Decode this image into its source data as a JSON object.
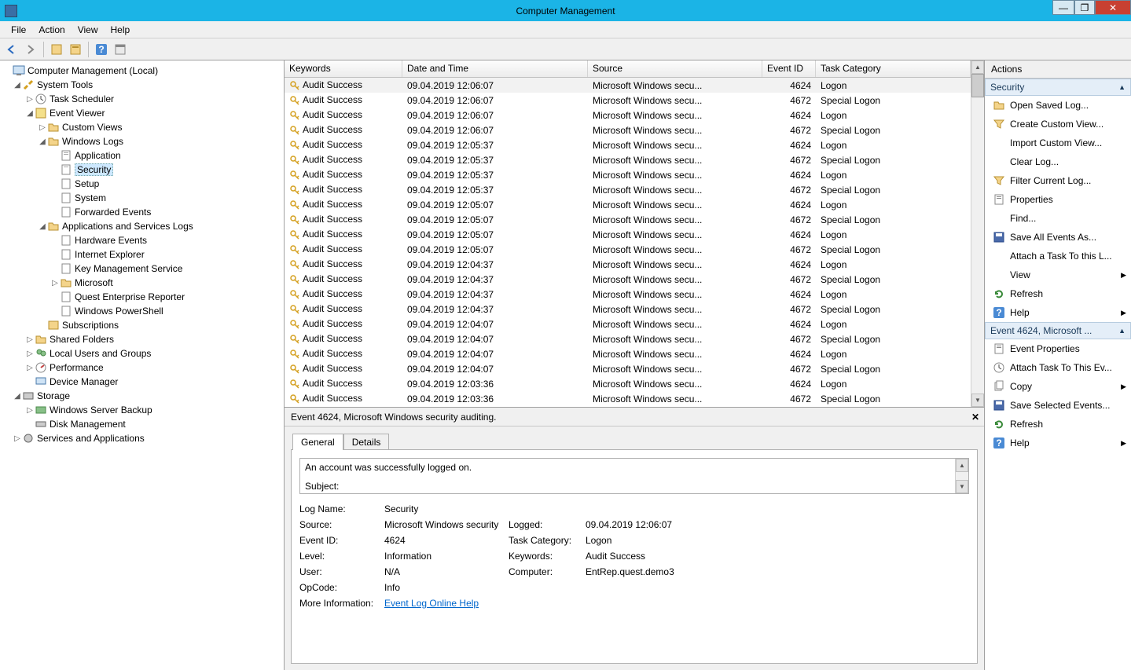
{
  "window": {
    "title": "Computer Management"
  },
  "menubar": [
    "File",
    "Action",
    "View",
    "Help"
  ],
  "tree": {
    "root": "Computer Management (Local)",
    "system_tools": "System Tools",
    "task_scheduler": "Task Scheduler",
    "event_viewer": "Event Viewer",
    "custom_views": "Custom Views",
    "windows_logs": "Windows Logs",
    "application": "Application",
    "security": "Security",
    "setup": "Setup",
    "system": "System",
    "forwarded": "Forwarded Events",
    "app_svc_logs": "Applications and Services Logs",
    "hw_events": "Hardware Events",
    "ie": "Internet Explorer",
    "kms": "Key Management Service",
    "microsoft": "Microsoft",
    "quest": "Quest Enterprise Reporter",
    "powershell": "Windows PowerShell",
    "subscriptions": "Subscriptions",
    "shared_folders": "Shared Folders",
    "local_users": "Local Users and Groups",
    "performance": "Performance",
    "device_manager": "Device Manager",
    "storage": "Storage",
    "wsb": "Windows Server Backup",
    "disk_mgmt": "Disk Management",
    "services_apps": "Services and Applications"
  },
  "table": {
    "headers": {
      "keywords": "Keywords",
      "datetime": "Date and Time",
      "source": "Source",
      "eventid": "Event ID",
      "taskcat": "Task Category"
    },
    "rows": [
      {
        "kw": "Audit Success",
        "dt": "09.04.2019 12:06:07",
        "src": "Microsoft Windows secu...",
        "eid": "4624",
        "tc": "Logon",
        "sel": true
      },
      {
        "kw": "Audit Success",
        "dt": "09.04.2019 12:06:07",
        "src": "Microsoft Windows secu...",
        "eid": "4672",
        "tc": "Special Logon"
      },
      {
        "kw": "Audit Success",
        "dt": "09.04.2019 12:06:07",
        "src": "Microsoft Windows secu...",
        "eid": "4624",
        "tc": "Logon"
      },
      {
        "kw": "Audit Success",
        "dt": "09.04.2019 12:06:07",
        "src": "Microsoft Windows secu...",
        "eid": "4672",
        "tc": "Special Logon"
      },
      {
        "kw": "Audit Success",
        "dt": "09.04.2019 12:05:37",
        "src": "Microsoft Windows secu...",
        "eid": "4624",
        "tc": "Logon"
      },
      {
        "kw": "Audit Success",
        "dt": "09.04.2019 12:05:37",
        "src": "Microsoft Windows secu...",
        "eid": "4672",
        "tc": "Special Logon"
      },
      {
        "kw": "Audit Success",
        "dt": "09.04.2019 12:05:37",
        "src": "Microsoft Windows secu...",
        "eid": "4624",
        "tc": "Logon"
      },
      {
        "kw": "Audit Success",
        "dt": "09.04.2019 12:05:37",
        "src": "Microsoft Windows secu...",
        "eid": "4672",
        "tc": "Special Logon"
      },
      {
        "kw": "Audit Success",
        "dt": "09.04.2019 12:05:07",
        "src": "Microsoft Windows secu...",
        "eid": "4624",
        "tc": "Logon"
      },
      {
        "kw": "Audit Success",
        "dt": "09.04.2019 12:05:07",
        "src": "Microsoft Windows secu...",
        "eid": "4672",
        "tc": "Special Logon"
      },
      {
        "kw": "Audit Success",
        "dt": "09.04.2019 12:05:07",
        "src": "Microsoft Windows secu...",
        "eid": "4624",
        "tc": "Logon"
      },
      {
        "kw": "Audit Success",
        "dt": "09.04.2019 12:05:07",
        "src": "Microsoft Windows secu...",
        "eid": "4672",
        "tc": "Special Logon"
      },
      {
        "kw": "Audit Success",
        "dt": "09.04.2019 12:04:37",
        "src": "Microsoft Windows secu...",
        "eid": "4624",
        "tc": "Logon"
      },
      {
        "kw": "Audit Success",
        "dt": "09.04.2019 12:04:37",
        "src": "Microsoft Windows secu...",
        "eid": "4672",
        "tc": "Special Logon"
      },
      {
        "kw": "Audit Success",
        "dt": "09.04.2019 12:04:37",
        "src": "Microsoft Windows secu...",
        "eid": "4624",
        "tc": "Logon"
      },
      {
        "kw": "Audit Success",
        "dt": "09.04.2019 12:04:37",
        "src": "Microsoft Windows secu...",
        "eid": "4672",
        "tc": "Special Logon"
      },
      {
        "kw": "Audit Success",
        "dt": "09.04.2019 12:04:07",
        "src": "Microsoft Windows secu...",
        "eid": "4624",
        "tc": "Logon"
      },
      {
        "kw": "Audit Success",
        "dt": "09.04.2019 12:04:07",
        "src": "Microsoft Windows secu...",
        "eid": "4672",
        "tc": "Special Logon"
      },
      {
        "kw": "Audit Success",
        "dt": "09.04.2019 12:04:07",
        "src": "Microsoft Windows secu...",
        "eid": "4624",
        "tc": "Logon"
      },
      {
        "kw": "Audit Success",
        "dt": "09.04.2019 12:04:07",
        "src": "Microsoft Windows secu...",
        "eid": "4672",
        "tc": "Special Logon"
      },
      {
        "kw": "Audit Success",
        "dt": "09.04.2019 12:03:36",
        "src": "Microsoft Windows secu...",
        "eid": "4624",
        "tc": "Logon"
      },
      {
        "kw": "Audit Success",
        "dt": "09.04.2019 12:03:36",
        "src": "Microsoft Windows secu...",
        "eid": "4672",
        "tc": "Special Logon"
      }
    ]
  },
  "detail": {
    "title": "Event 4624, Microsoft Windows security auditing.",
    "tabs": {
      "general": "General",
      "details": "Details"
    },
    "desc_line1": "An account was successfully logged on.",
    "desc_line2": "Subject:",
    "labels": {
      "log_name": "Log Name:",
      "source": "Source:",
      "logged": "Logged:",
      "event_id": "Event ID:",
      "task_cat": "Task Category:",
      "level": "Level:",
      "keywords": "Keywords:",
      "user": "User:",
      "computer": "Computer:",
      "opcode": "OpCode:",
      "more_info": "More Information:"
    },
    "values": {
      "log_name": "Security",
      "source": "Microsoft Windows security",
      "logged": "09.04.2019 12:06:07",
      "event_id": "4624",
      "task_cat": "Logon",
      "level": "Information",
      "keywords": "Audit Success",
      "user": "N/A",
      "computer": "EntRep.quest.demo3",
      "opcode": "Info",
      "more_info": "Event Log Online Help"
    }
  },
  "actions": {
    "header": "Actions",
    "section1": "Security",
    "section2": "Event 4624, Microsoft ...",
    "items1": [
      {
        "label": "Open Saved Log...",
        "icon": "folder"
      },
      {
        "label": "Create Custom View...",
        "icon": "funnel"
      },
      {
        "label": "Import Custom View...",
        "icon": ""
      },
      {
        "label": "Clear Log...",
        "icon": ""
      },
      {
        "label": "Filter Current Log...",
        "icon": "funnel"
      },
      {
        "label": "Properties",
        "icon": "props"
      },
      {
        "label": "Find...",
        "icon": ""
      },
      {
        "label": "Save All Events As...",
        "icon": "save"
      },
      {
        "label": "Attach a Task To this L...",
        "icon": ""
      },
      {
        "label": "View",
        "icon": "",
        "sub": true
      },
      {
        "label": "Refresh",
        "icon": "refresh"
      },
      {
        "label": "Help",
        "icon": "help",
        "sub": true
      }
    ],
    "items2": [
      {
        "label": "Event Properties",
        "icon": "props"
      },
      {
        "label": "Attach Task To This Ev...",
        "icon": "task"
      },
      {
        "label": "Copy",
        "icon": "copy",
        "sub": true
      },
      {
        "label": "Save Selected Events...",
        "icon": "save"
      },
      {
        "label": "Refresh",
        "icon": "refresh"
      },
      {
        "label": "Help",
        "icon": "help",
        "sub": true
      }
    ]
  }
}
